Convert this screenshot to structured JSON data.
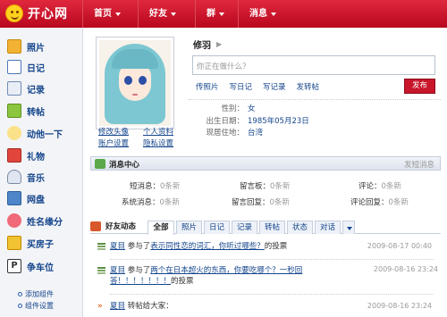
{
  "header": {
    "logo_text": "开心网",
    "nav": [
      "首页",
      "好友",
      "群",
      "消息"
    ]
  },
  "sidebar": {
    "items": [
      {
        "label": "照片",
        "icon": "photo-icon"
      },
      {
        "label": "日记",
        "icon": "diary-icon"
      },
      {
        "label": "记录",
        "icon": "record-icon"
      },
      {
        "label": "转帖",
        "icon": "repost-icon"
      },
      {
        "label": "动他一下",
        "icon": "poke-icon"
      },
      {
        "label": "礼物",
        "icon": "gift-icon"
      },
      {
        "label": "音乐",
        "icon": "music-icon"
      },
      {
        "label": "网盘",
        "icon": "disk-icon"
      },
      {
        "label": "姓名缘分",
        "icon": "name-match-icon"
      },
      {
        "label": "买房子",
        "icon": "house-icon"
      },
      {
        "label": "争车位",
        "icon": "parking-icon"
      }
    ],
    "sub_links": [
      "添加组件",
      "组件设置"
    ]
  },
  "profile": {
    "username": "修羽",
    "status_placeholder": "你正在做什么？",
    "actions": [
      "传照片",
      "写日记",
      "写记录",
      "发转帖"
    ],
    "publish_label": "发布",
    "links": [
      "修改头像",
      "个人资料",
      "账户设置",
      "隐私设置"
    ],
    "info": [
      {
        "label": "性别：",
        "value": "女"
      },
      {
        "label": "出生日期：",
        "value": "1985年05月23日"
      },
      {
        "label": "现居住地：",
        "value": "台湾"
      }
    ]
  },
  "message_center": {
    "title": "消息中心",
    "right_link": "发短消息",
    "cells": [
      {
        "label": "短消息：",
        "count": "0条新"
      },
      {
        "label": "留言板：",
        "count": "0条新"
      },
      {
        "label": "评论：",
        "count": "0条新"
      },
      {
        "label": "系统消息：",
        "count": "0条新"
      },
      {
        "label": "留言回复：",
        "count": "0条新"
      },
      {
        "label": "评论回复：",
        "count": "0条新"
      }
    ]
  },
  "feed": {
    "title": "好友动态",
    "tabs": [
      "全部",
      "照片",
      "日记",
      "记录",
      "转帖",
      "状态",
      "对话"
    ],
    "items": [
      {
        "user": "夏目",
        "pre": "参与了",
        "link": "表示同性恋的词汇，你听过哪些？",
        "post": "的投票",
        "time": "2009-08-17 00:40"
      },
      {
        "user": "夏目",
        "pre": "参与了",
        "link": "两个在日本超火的东西，你要吃哪个？一秒回答！！！！！！！",
        "post": "的投票",
        "time": "2009-08-16 23:24"
      },
      {
        "user": "夏目",
        "pre": "转帖给大家：",
        "link": "",
        "post": "",
        "time": "2009-08-16 23:24"
      }
    ]
  },
  "colors": {
    "header_red": "#c8102e",
    "link_blue": "#14458c",
    "sidebar_bg": "#f3f4f7"
  }
}
